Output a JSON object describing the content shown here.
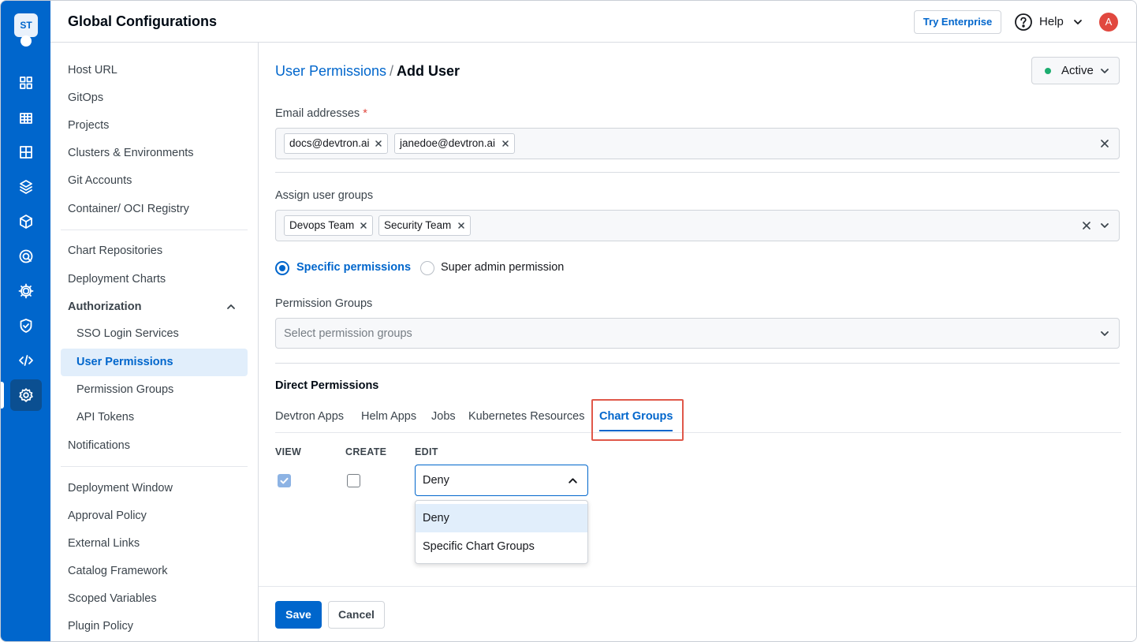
{
  "app": {
    "logo_text": "ST",
    "page_title": "Global Configurations",
    "colors": {
      "primary": "#0066cc",
      "danger": "#e1483f",
      "success": "#1dad70",
      "highlight": "#e0584a"
    }
  },
  "rail": {
    "icons": [
      "overview-icon",
      "applications-icon",
      "jobs-icon",
      "chart-store-icon",
      "resource-browser-icon",
      "security-icon",
      "bulk-edit-icon",
      "shield-icon",
      "code-icon",
      "settings-icon"
    ]
  },
  "header": {
    "try_enterprise": "Try Enterprise",
    "help": "Help",
    "avatar_initial": "A"
  },
  "nav": {
    "section1": [
      "Host URL",
      "GitOps",
      "Projects",
      "Clusters & Environments",
      "Git Accounts",
      "Container/ OCI Registry"
    ],
    "section2": [
      "Chart Repositories",
      "Deployment Charts"
    ],
    "group_label": "Authorization",
    "group_items": [
      "SSO Login Services",
      "User Permissions",
      "Permission Groups",
      "API Tokens"
    ],
    "after_group": "Notifications",
    "section3": [
      "Deployment Window",
      "Approval Policy",
      "External Links",
      "Catalog Framework",
      "Scoped Variables",
      "Plugin Policy"
    ]
  },
  "breadcrumb": {
    "parent": "User Permissions",
    "separator": "/",
    "current": "Add User"
  },
  "status": {
    "label": "Active"
  },
  "email": {
    "label": "Email addresses",
    "required_mark": "*",
    "chips": [
      "docs@devtron.ai",
      "janedoe@devtron.ai"
    ]
  },
  "user_groups": {
    "label": "Assign user groups",
    "chips": [
      "Devops Team",
      "Security Team"
    ]
  },
  "permission_type": {
    "specific": "Specific permissions",
    "super_admin": "Super admin permission",
    "selected": "specific"
  },
  "permission_groups": {
    "label": "Permission Groups",
    "placeholder": "Select permission groups"
  },
  "direct_permissions": {
    "title": "Direct Permissions",
    "tabs": [
      "Devtron Apps",
      "Helm Apps",
      "Jobs",
      "Kubernetes Resources",
      "Chart Groups"
    ],
    "active_tab": "Chart Groups",
    "columns": {
      "view": "VIEW",
      "create": "CREATE",
      "edit": "EDIT"
    },
    "view_checked": true,
    "create_checked": false,
    "edit_value": "Deny",
    "edit_options": [
      "Deny",
      "Specific Chart Groups"
    ]
  },
  "footer": {
    "save": "Save",
    "cancel": "Cancel"
  }
}
